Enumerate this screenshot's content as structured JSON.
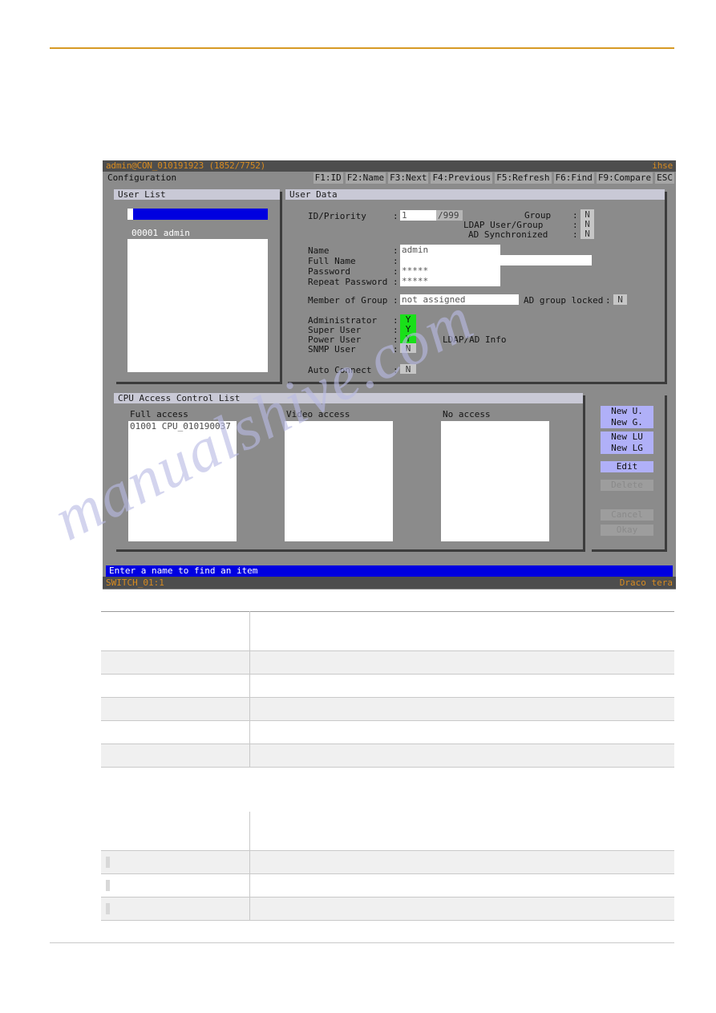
{
  "osd": {
    "titlebar": {
      "session": "admin@CON_010191923 (1852/7752)",
      "brand": "ihse"
    },
    "menubar": {
      "title": "Configuration",
      "function_keys": [
        "F1:ID",
        "F2:Name",
        "F3:Next",
        "F4:Previous",
        "F5:Refresh",
        "F6:Find",
        "F9:Compare",
        "ESC"
      ]
    },
    "user_list": {
      "title": "User List",
      "search_value": "",
      "search_placeholder": "",
      "items": [
        {
          "id": "00001",
          "name": "admin",
          "label": "00001 admin",
          "selected": true
        }
      ]
    },
    "user_data": {
      "title": "User Data",
      "fields": {
        "id_priority_label": "ID/Priority",
        "id_value": "1",
        "priority_value": "/999",
        "name_label": "Name",
        "name_value": "admin",
        "full_name_label": "Full Name",
        "full_name_value": "",
        "password_label": "Password",
        "password_value": "*****",
        "repeat_password_label": "Repeat Password",
        "repeat_password_value": "*****",
        "member_of_group_label": "Member of Group",
        "member_of_group_value": "not assigned",
        "ad_group_locked_label": "AD group locked",
        "ad_group_locked_value": "N",
        "group_label": "Group",
        "group_value": "N",
        "ldap_user_group_label": "LDAP User/Group",
        "ldap_user_group_value": "N",
        "ad_synchronized_label": "AD Synchronized",
        "ad_synchronized_value": "N",
        "administrator_label": "Administrator",
        "administrator_value": "Y",
        "super_user_label": "Super User",
        "super_user_value": "Y",
        "power_user_label": "Power User",
        "power_user_value": "Y",
        "snmp_user_label": "SNMP User",
        "snmp_user_value": "N",
        "auto_connect_label": "Auto Connect",
        "auto_connect_value": "N",
        "ldap_ad_info_label": "LDAP/AD Info"
      }
    },
    "cpu_acl": {
      "title": "CPU Access Control List",
      "columns": [
        {
          "header": "Full access",
          "entries": [
            "01001 CPU_010190037"
          ]
        },
        {
          "header": "Video access",
          "entries": []
        },
        {
          "header": "No access",
          "entries": []
        }
      ]
    },
    "buttons": [
      {
        "label": "New U.",
        "enabled": true
      },
      {
        "label": "New G.",
        "enabled": true
      },
      {
        "label": "New LU",
        "enabled": true
      },
      {
        "label": "New LG",
        "enabled": true
      },
      {
        "label": "Edit",
        "enabled": true
      },
      {
        "label": "Delete",
        "enabled": false
      },
      {
        "label": "Cancel",
        "enabled": false
      },
      {
        "label": "Okay",
        "enabled": false
      }
    ],
    "hint": "Enter a name to find an item",
    "status": {
      "left": "SWITCH_01:1",
      "right": "Draco tera"
    }
  },
  "document": {
    "watermark": "manualshive.com",
    "table_1": {
      "rows": [
        {
          "c1": "",
          "c2": "",
          "shaded": false,
          "head": true
        },
        {
          "c1": "",
          "c2": "",
          "shaded": true
        },
        {
          "c1": "",
          "c2": "",
          "shaded": false
        },
        {
          "c1": "",
          "c2": "",
          "shaded": true
        },
        {
          "c1": "",
          "c2": "",
          "shaded": false
        },
        {
          "c1": "",
          "c2": "",
          "shaded": true
        }
      ]
    },
    "table_2": {
      "rows": [
        {
          "c1": "",
          "c2": "",
          "shaded": false,
          "head": true
        },
        {
          "c1": "",
          "c2": "",
          "shaded": true,
          "chip": true
        },
        {
          "c1": "",
          "c2": "",
          "shaded": false,
          "chip": true
        },
        {
          "c1": "",
          "c2": "",
          "shaded": true,
          "chip": true
        }
      ]
    }
  },
  "colors": {
    "accent_rule": "#d79a25",
    "osd_background": "#8b8b8b",
    "osd_titlebar": "#4d4d4d",
    "osd_titlebar_text": "#d88b20",
    "panel_head": "#c9c9d6",
    "highlight_blue": "#0000e0",
    "flag_yes_green": "#19e019",
    "button_active": "#b0b0f8",
    "button_disabled": "#9d9d9d"
  }
}
